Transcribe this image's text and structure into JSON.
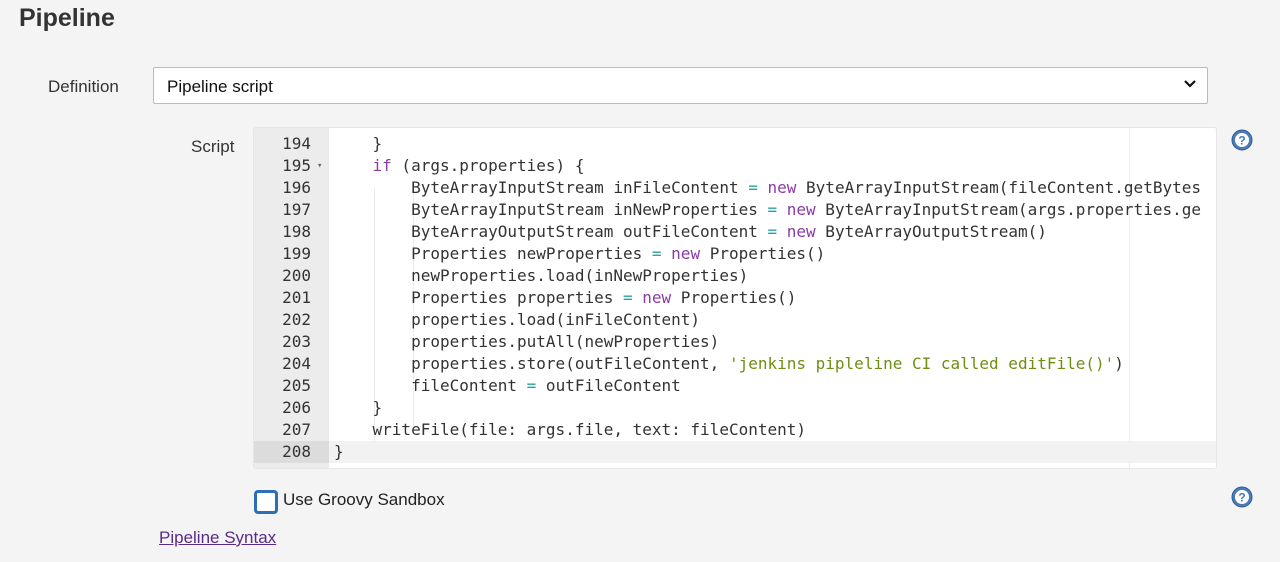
{
  "section": {
    "title": "Pipeline"
  },
  "definition": {
    "label": "Definition",
    "selected": "Pipeline script"
  },
  "script": {
    "label": "Script",
    "lines": [
      {
        "n": "194",
        "segs": [
          [
            "    }",
            ""
          ]
        ]
      },
      {
        "n": "195",
        "fold": "▾",
        "segs": [
          [
            "    ",
            ""
          ],
          [
            "if",
            "kw"
          ],
          [
            " (args.properties) {",
            ""
          ]
        ]
      },
      {
        "n": "196",
        "segs": [
          [
            "        ByteArrayInputStream inFileContent ",
            ""
          ],
          [
            "=",
            "op"
          ],
          [
            " ",
            ""
          ],
          [
            "new",
            "kw"
          ],
          [
            " ByteArrayInputStream(fileContent.getBytes",
            ""
          ]
        ]
      },
      {
        "n": "197",
        "segs": [
          [
            "        ByteArrayInputStream inNewProperties ",
            ""
          ],
          [
            "=",
            "op"
          ],
          [
            " ",
            ""
          ],
          [
            "new",
            "kw"
          ],
          [
            " ByteArrayInputStream(args.properties.ge",
            ""
          ]
        ]
      },
      {
        "n": "198",
        "segs": [
          [
            "        ByteArrayOutputStream outFileContent ",
            ""
          ],
          [
            "=",
            "op"
          ],
          [
            " ",
            ""
          ],
          [
            "new",
            "kw"
          ],
          [
            " ByteArrayOutputStream()",
            ""
          ]
        ]
      },
      {
        "n": "199",
        "segs": [
          [
            "        Properties newProperties ",
            ""
          ],
          [
            "=",
            "op"
          ],
          [
            " ",
            ""
          ],
          [
            "new",
            "kw"
          ],
          [
            " Properties()",
            ""
          ]
        ]
      },
      {
        "n": "200",
        "segs": [
          [
            "        newProperties.load(inNewProperties)",
            ""
          ]
        ]
      },
      {
        "n": "201",
        "segs": [
          [
            "        Properties properties ",
            ""
          ],
          [
            "=",
            "op"
          ],
          [
            " ",
            ""
          ],
          [
            "new",
            "kw"
          ],
          [
            " Properties()",
            ""
          ]
        ]
      },
      {
        "n": "202",
        "segs": [
          [
            "        properties.load(inFileContent)",
            ""
          ]
        ]
      },
      {
        "n": "203",
        "segs": [
          [
            "        properties.putAll(newProperties)",
            ""
          ]
        ]
      },
      {
        "n": "204",
        "segs": [
          [
            "        properties.store(outFileContent, ",
            ""
          ],
          [
            "'jenkins pipleline CI called editFile()'",
            "str"
          ],
          [
            ")",
            ""
          ]
        ]
      },
      {
        "n": "205",
        "segs": [
          [
            "        fileContent ",
            ""
          ],
          [
            "=",
            "op"
          ],
          [
            " outFileContent",
            ""
          ]
        ]
      },
      {
        "n": "206",
        "segs": [
          [
            "    }",
            ""
          ]
        ]
      },
      {
        "n": "207",
        "segs": [
          [
            "    writeFile(file: args.file, text: fileContent)",
            ""
          ]
        ]
      },
      {
        "n": "208",
        "segs": [
          [
            "}",
            ""
          ]
        ],
        "active": true
      }
    ]
  },
  "sandbox": {
    "label": "Use Groovy Sandbox",
    "checked": false
  },
  "links": {
    "pipeline_syntax": "Pipeline Syntax"
  },
  "colors": {
    "keyword": "#8a3aa7",
    "operator": "#2aa19a",
    "string": "#6e8e12",
    "checkbox_border": "#2d6fb4",
    "link": "#5b2b8a"
  },
  "icons": {
    "help": "help-icon",
    "dropdown": "chevron-down-icon"
  }
}
